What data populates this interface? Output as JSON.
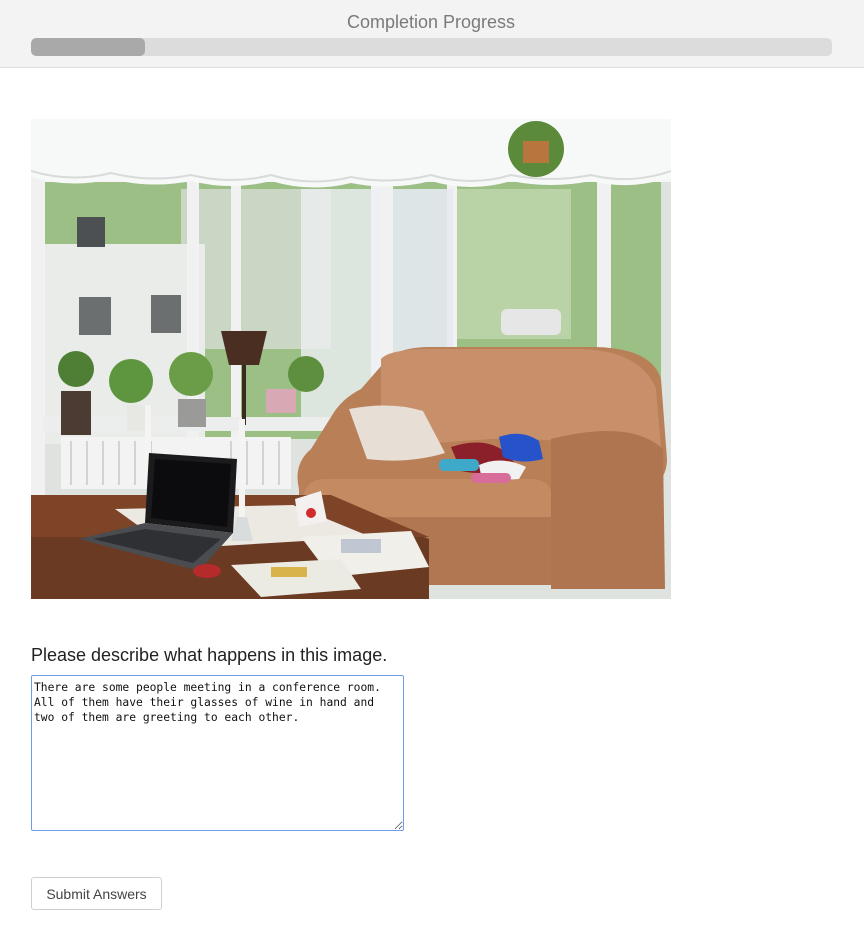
{
  "progress": {
    "title": "Completion Progress",
    "fraction": 0.142
  },
  "photo": {
    "subject": "living-room-photo"
  },
  "question": {
    "prompt": "Please describe what happens in this image.",
    "answer": "There are some people meeting in a conference room. All of them have their glasses of wine in hand and two of them are greeting to each other."
  },
  "actions": {
    "submit_label": "Submit Answers"
  },
  "colors": {
    "header_bg": "#f3f3f3",
    "progress_track": "#dcdcdc",
    "progress_fill": "#a9a9a9",
    "input_focus_border": "#6f9ce8"
  }
}
